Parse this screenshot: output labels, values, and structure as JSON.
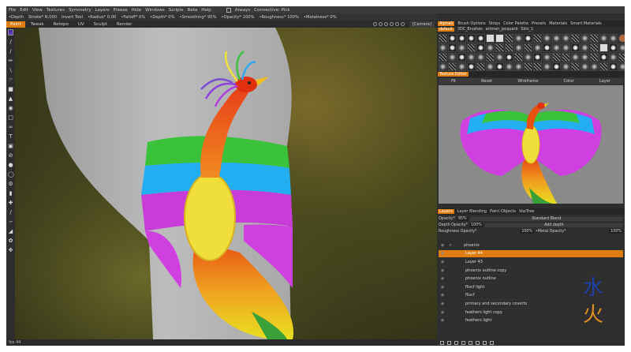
{
  "menu": {
    "items": [
      "File",
      "Edit",
      "View",
      "Textures",
      "Symmetry",
      "Layers",
      "Freeze",
      "Hide",
      "Windows",
      "Scripts",
      "Beta",
      "Help"
    ],
    "always_label": "Always",
    "connective_label": "Connective: Pick"
  },
  "toolbar": {
    "items": [
      "•Depth",
      "Stroke* N.000",
      "Invert Tool",
      "•Radius* 0.00",
      "•Falloff* 0%",
      "•Depth* 0%",
      "•Smoothing* 95%",
      "•Opacity* 100%",
      "•Roughness* 100%",
      "•Metalness* 0%"
    ]
  },
  "rooms": {
    "tabs": [
      "Paint",
      "Tweak",
      "Retopo",
      "UV",
      "Sculpt",
      "Render"
    ],
    "active": "Paint",
    "camera_label": "[Camera]"
  },
  "right_panel": {
    "brush_tabs": [
      "AlphaS",
      "Brush Options",
      "Strips",
      "Color Palette",
      "Presets",
      "Materials",
      "Smart Materials"
    ],
    "alpha_row": [
      "default",
      "3DC_Brushes",
      "artman_jacquard",
      "Skin_1"
    ],
    "texture_editor_title": "Texture Editor",
    "texture_bar": [
      "Fit",
      "Reset",
      "Wireframe",
      "Color",
      "Layer"
    ],
    "layers_tabs": [
      "Layers",
      "Layer Blending",
      "Paint Objects",
      "VoxTree"
    ],
    "props": {
      "opacity_label": "Opacity*",
      "opacity_value": "95%",
      "blend_mode": "Standard Blend",
      "depth_label": "Depth Opacity*",
      "depth_value": "100%",
      "depth_mode": "Add depth",
      "rough_label": "Roughness Opacity*",
      "rough_value": "100%",
      "metal_label": "•Metal Opacity*",
      "metal_value": "100%"
    },
    "layers": [
      {
        "name": "phoenix",
        "group": true,
        "selected": false
      },
      {
        "name": "Layer 44",
        "group": false,
        "selected": true
      },
      {
        "name": "Layer 43",
        "group": false,
        "selected": false
      },
      {
        "name": "phoenix outline copy",
        "group": false,
        "selected": false
      },
      {
        "name": "phoenix outline",
        "group": false,
        "selected": false
      },
      {
        "name": "fliscf light",
        "group": false,
        "selected": false
      },
      {
        "name": "fliscf",
        "group": false,
        "selected": false
      },
      {
        "name": "primary and secondary coverts",
        "group": false,
        "selected": false
      },
      {
        "name": "feathers light copy",
        "group": false,
        "selected": false
      },
      {
        "name": "feathers light",
        "group": false,
        "selected": false
      }
    ],
    "kanji": [
      "水",
      "火"
    ]
  },
  "status": {
    "text": "fps 44"
  },
  "colors": {
    "accent": "#e07d10",
    "panel_bg": "#2e2e2e"
  }
}
